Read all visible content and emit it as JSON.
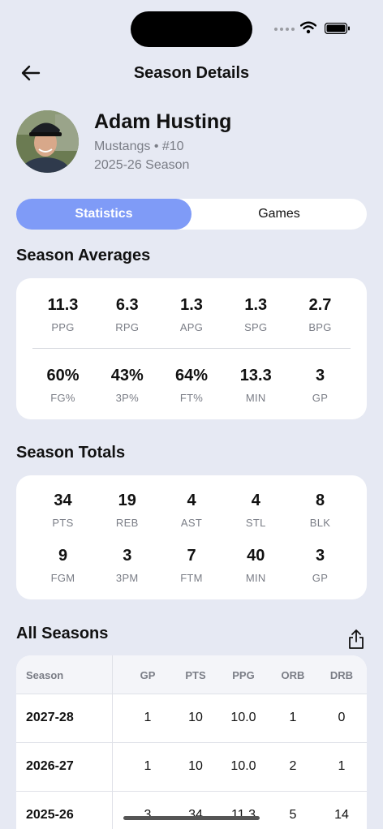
{
  "nav": {
    "title": "Season Details"
  },
  "player": {
    "name": "Adam Husting",
    "team_line": "Mustangs • #10",
    "season_line": "2025-26 Season"
  },
  "tabs": {
    "statistics": "Statistics",
    "games": "Games"
  },
  "averages": {
    "title": "Season Averages",
    "row1": [
      {
        "value": "11.3",
        "label": "PPG"
      },
      {
        "value": "6.3",
        "label": "RPG"
      },
      {
        "value": "1.3",
        "label": "APG"
      },
      {
        "value": "1.3",
        "label": "SPG"
      },
      {
        "value": "2.7",
        "label": "BPG"
      }
    ],
    "row2": [
      {
        "value": "60%",
        "label": "FG%"
      },
      {
        "value": "43%",
        "label": "3P%"
      },
      {
        "value": "64%",
        "label": "FT%"
      },
      {
        "value": "13.3",
        "label": "MIN"
      },
      {
        "value": "3",
        "label": "GP"
      }
    ]
  },
  "totals": {
    "title": "Season Totals",
    "row1": [
      {
        "value": "34",
        "label": "PTS"
      },
      {
        "value": "19",
        "label": "REB"
      },
      {
        "value": "4",
        "label": "AST"
      },
      {
        "value": "4",
        "label": "STL"
      },
      {
        "value": "8",
        "label": "BLK"
      }
    ],
    "row2": [
      {
        "value": "9",
        "label": "FGM"
      },
      {
        "value": "3",
        "label": "3PM"
      },
      {
        "value": "7",
        "label": "FTM"
      },
      {
        "value": "40",
        "label": "MIN"
      },
      {
        "value": "3",
        "label": "GP"
      }
    ]
  },
  "all_seasons": {
    "title": "All Seasons",
    "columns": [
      "Season",
      "GP",
      "PTS",
      "PPG",
      "ORB",
      "DRB"
    ],
    "rows": [
      {
        "season": "2027-28",
        "gp": "1",
        "pts": "10",
        "ppg": "10.0",
        "orb": "1",
        "drb": "0"
      },
      {
        "season": "2026-27",
        "gp": "1",
        "pts": "10",
        "ppg": "10.0",
        "orb": "2",
        "drb": "1"
      },
      {
        "season": "2025-26",
        "gp": "3",
        "pts": "34",
        "ppg": "11.3",
        "orb": "5",
        "drb": "14"
      }
    ]
  },
  "colors": {
    "accent": "#7f9bf7",
    "background": "#e6e9f3"
  }
}
